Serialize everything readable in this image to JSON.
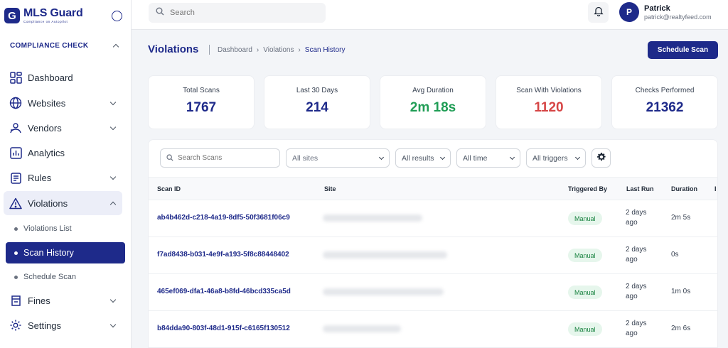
{
  "app": {
    "logo_letter": "G",
    "logo_title": "MLS Guard",
    "logo_tagline": "Compliance on Autopilot"
  },
  "sidebar": {
    "section_title": "COMPLIANCE CHECK",
    "items": [
      {
        "label": "Dashboard",
        "icon": "dashboard-icon",
        "has_chevron": false
      },
      {
        "label": "Websites",
        "icon": "www-icon",
        "has_chevron": true
      },
      {
        "label": "Vendors",
        "icon": "vendors-icon",
        "has_chevron": true
      },
      {
        "label": "Analytics",
        "icon": "analytics-icon",
        "has_chevron": false
      },
      {
        "label": "Rules",
        "icon": "rules-icon",
        "has_chevron": true
      },
      {
        "label": "Violations",
        "icon": "warning-icon",
        "has_chevron": true,
        "expanded": true
      },
      {
        "label": "Fines",
        "icon": "fines-icon",
        "has_chevron": true
      },
      {
        "label": "Settings",
        "icon": "settings-icon",
        "has_chevron": true
      }
    ],
    "violations_sub": [
      {
        "label": "Violations List"
      },
      {
        "label": "Scan History",
        "active": true
      },
      {
        "label": "Schedule Scan"
      }
    ]
  },
  "topbar": {
    "search_placeholder": "Search",
    "user_initial": "P",
    "user_name": "Patrick",
    "user_email": "patrick@realtyfeed.com"
  },
  "header": {
    "title": "Violations",
    "breadcrumb": [
      "Dashboard",
      "Violations",
      "Scan History"
    ],
    "separators": [
      "›",
      "›"
    ],
    "schedule_button": "Schedule Scan"
  },
  "stats": [
    {
      "label": "Total Scans",
      "value": "1767",
      "color": "#1e2a8a"
    },
    {
      "label": "Last 30 Days",
      "value": "214",
      "color": "#1e2a8a"
    },
    {
      "label": "Avg Duration",
      "value": "2m 18s",
      "color": "#1f9d55"
    },
    {
      "label": "Scan With Violations",
      "value": "1120",
      "color": "#d64545"
    },
    {
      "label": "Checks Performed",
      "value": "21362",
      "color": "#1e2a8a"
    }
  ],
  "filters": {
    "search_placeholder": "Search Scans",
    "sites": "All sites",
    "results": "All results",
    "time": "All time",
    "triggers": "All triggers"
  },
  "table": {
    "columns": [
      "Scan ID",
      "Site",
      "Triggered By",
      "Last Run",
      "Duration"
    ],
    "rows": [
      {
        "id": "ab4b462d-c218-4a19-8df5-50f3681f06c9",
        "trigger": "Manual",
        "last_run": "2 days ago",
        "duration": "2m 5s"
      },
      {
        "id": "f7ad8438-b031-4e9f-a193-5f8c88448402",
        "trigger": "Manual",
        "last_run": "2 days ago",
        "duration": "0s"
      },
      {
        "id": "465ef069-dfa1-46a8-b8fd-46bcd335ca5d",
        "trigger": "Manual",
        "last_run": "2 days ago",
        "duration": "1m 0s"
      },
      {
        "id": "b84dda90-803f-48d1-915f-c6165f130512",
        "trigger": "Manual",
        "last_run": "2 days ago",
        "duration": "2m 6s"
      }
    ]
  }
}
